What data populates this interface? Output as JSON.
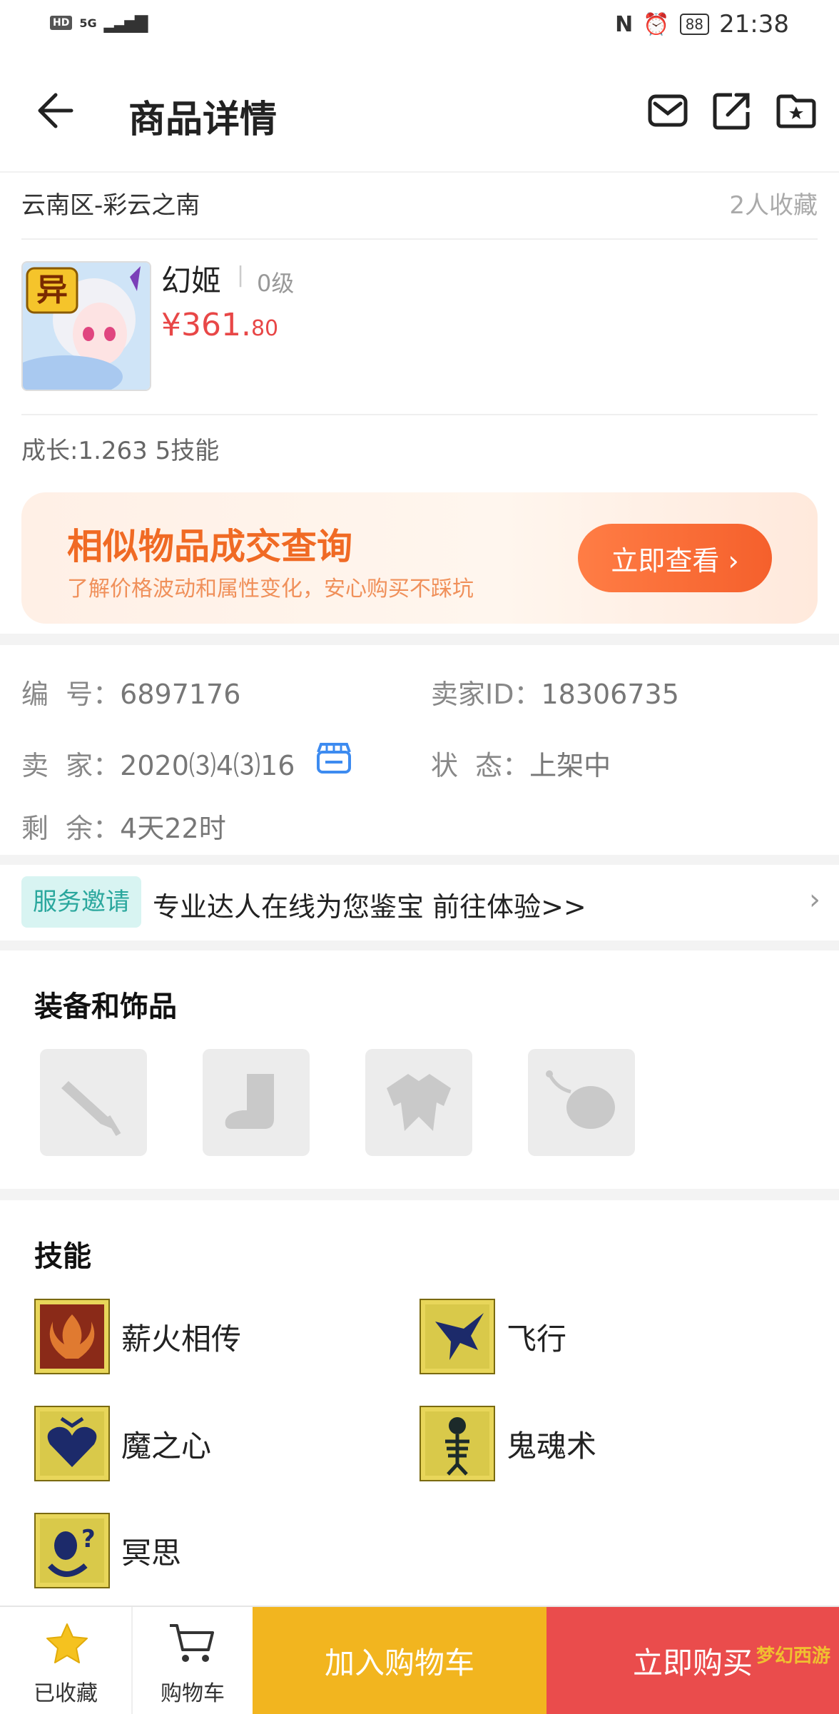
{
  "status_bar": {
    "network": "5G",
    "battery": "88",
    "time": "21:38"
  },
  "header": {
    "title": "商品详情"
  },
  "summary": {
    "location": "云南区-彩云之南",
    "favorites": "2人收藏"
  },
  "product": {
    "avatar_badge": "异",
    "name": "幻姬",
    "level": "0级",
    "price_main": "¥361.",
    "price_cents": "80",
    "growth": "成长:1.263 5技能"
  },
  "banner": {
    "title": "相似物品成交查询",
    "subtitle": "了解价格波动和属性变化，安心购买不踩坑",
    "button": "立即查看 ›"
  },
  "info": {
    "id_label": "编  号：",
    "id_value": "6897176",
    "seller_id_label": "卖家ID：",
    "seller_id_value": "18306735",
    "seller_label": "卖  家：",
    "seller_value": "2020⑶4⑶16",
    "status_label": "状  态：",
    "status_value": "上架中",
    "remain_label": "剩  余：",
    "remain_value": "4天22时"
  },
  "service": {
    "tag": "服务邀请",
    "text": "专业达人在线为您鉴宝 前往体验>>"
  },
  "equipment": {
    "title": "装备和饰品",
    "slots": [
      "weapon-icon",
      "boots-icon",
      "armor-icon",
      "accessory-icon"
    ]
  },
  "skills": {
    "title": "技能",
    "items": [
      {
        "name": "薪火相传",
        "icon": "phoenix-icon"
      },
      {
        "name": "飞行",
        "icon": "eagle-icon"
      },
      {
        "name": "魔之心",
        "icon": "heart-icon"
      },
      {
        "name": "鬼魂术",
        "icon": "skeleton-icon"
      },
      {
        "name": "冥思",
        "icon": "meditate-icon"
      }
    ]
  },
  "bottom_bar": {
    "favorited": "已收藏",
    "cart": "购物车",
    "add_to_cart": "加入购物车",
    "buy_now": "立即购买"
  },
  "watermark": "梦幻西游",
  "colors": {
    "accent_orange": "#f06a24",
    "price_red": "#e84747",
    "cart_yellow": "#f2b51f",
    "buy_red": "#ea4c4c",
    "service_teal": "#2aa79d"
  }
}
